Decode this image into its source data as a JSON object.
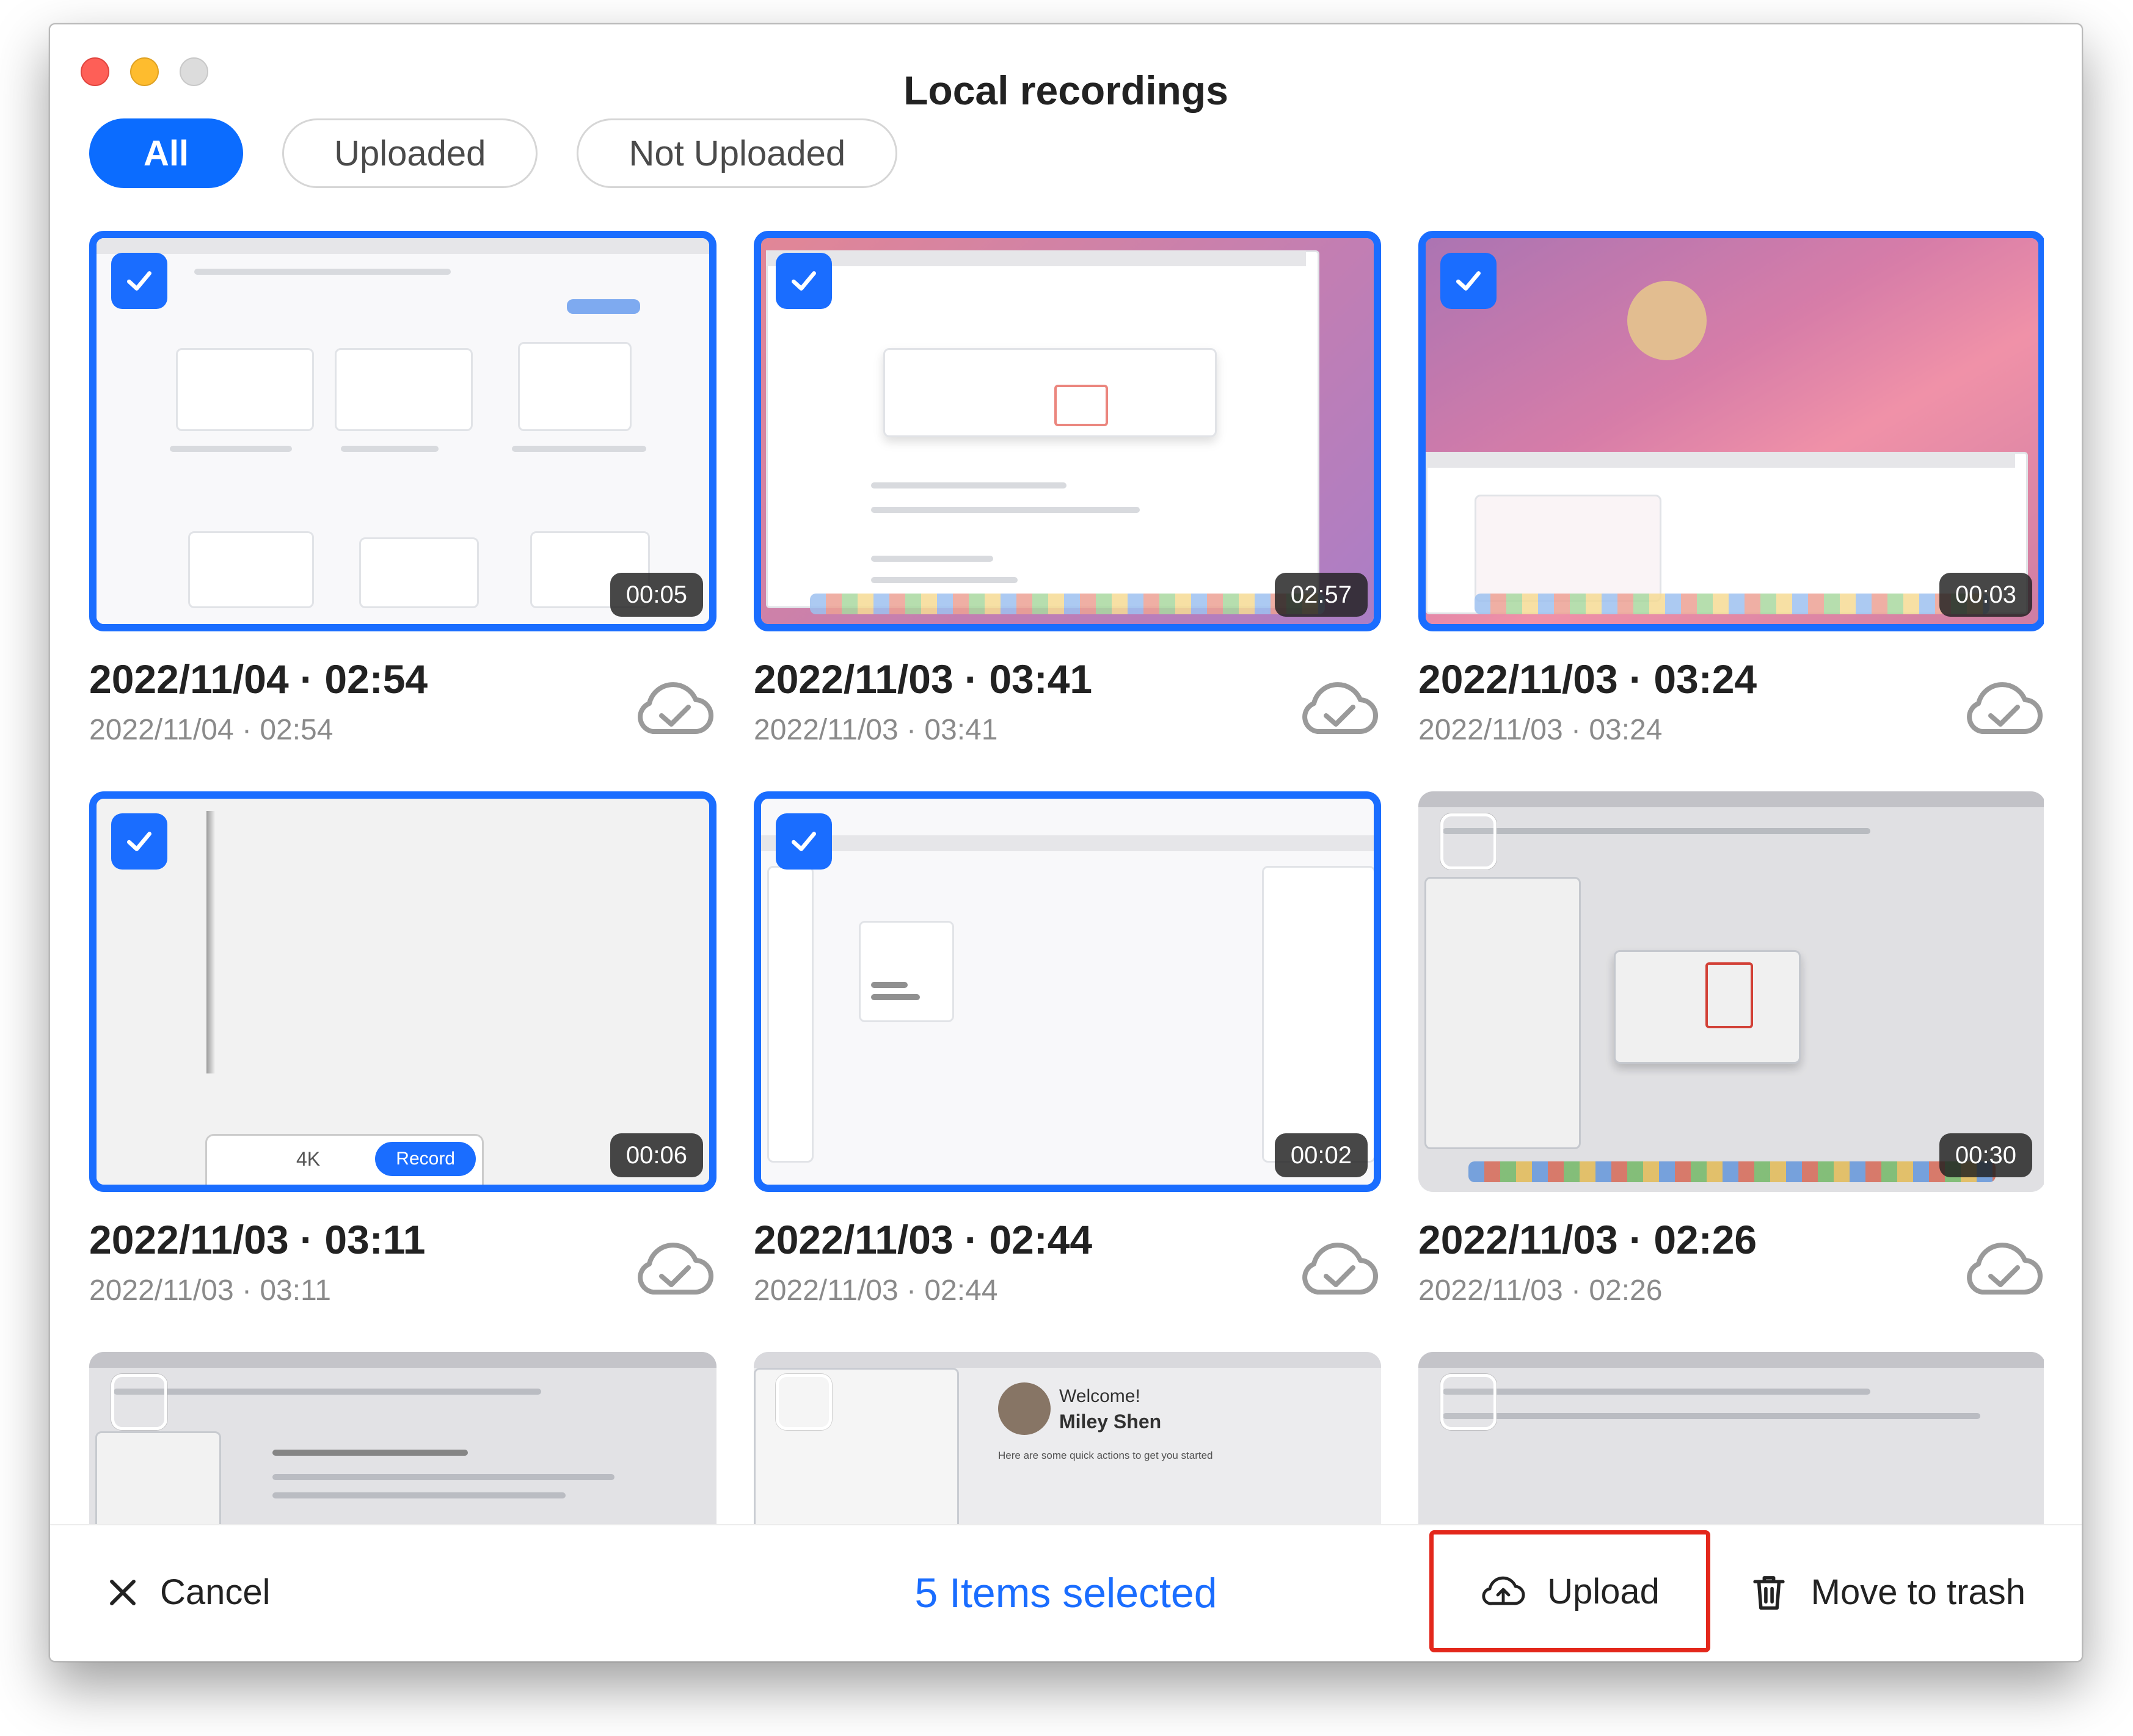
{
  "window": {
    "title": "Local recordings"
  },
  "filters": [
    {
      "label": "All",
      "active": true
    },
    {
      "label": "Uploaded",
      "active": false
    },
    {
      "label": "Not Uploaded",
      "active": false
    }
  ],
  "recordings": [
    {
      "title": "2022/11/04 · 02:54",
      "subtitle": "2022/11/04 · 02:54",
      "duration": "00:05",
      "selected": true,
      "uploaded_icon": "cloud-check-icon"
    },
    {
      "title": "2022/11/03 · 03:41",
      "subtitle": "2022/11/03 · 03:41",
      "duration": "02:57",
      "selected": true,
      "uploaded_icon": "cloud-check-icon"
    },
    {
      "title": "2022/11/03 · 03:24",
      "subtitle": "2022/11/03 · 03:24",
      "duration": "00:03",
      "selected": true,
      "uploaded_icon": "cloud-check-icon"
    },
    {
      "title": "2022/11/03 · 03:11",
      "subtitle": "2022/11/03 · 03:11",
      "duration": "00:06",
      "selected": true,
      "uploaded_icon": "cloud-check-icon"
    },
    {
      "title": "2022/11/03 · 02:44",
      "subtitle": "2022/11/03 · 02:44",
      "duration": "00:02",
      "selected": true,
      "uploaded_icon": "cloud-check-icon"
    },
    {
      "title": "2022/11/03 · 02:26",
      "subtitle": "2022/11/03 · 02:26",
      "duration": "00:30",
      "selected": false,
      "uploaded_icon": "cloud-check-icon"
    },
    {
      "selected": false
    },
    {
      "selected": false,
      "preview_text": {
        "welcome": "Welcome!",
        "name": "Miley Shen",
        "hint": "Here are some quick actions to get you started"
      }
    },
    {
      "selected": false
    }
  ],
  "thumbnail_text": {
    "record_button": "Record",
    "quality": "4K"
  },
  "footer": {
    "cancel_label": "Cancel",
    "selection_text": "5 Items selected",
    "upload_label": "Upload",
    "trash_label": "Move to trash"
  },
  "colors": {
    "accent": "#1a6dff",
    "highlight": "#e3271b"
  }
}
